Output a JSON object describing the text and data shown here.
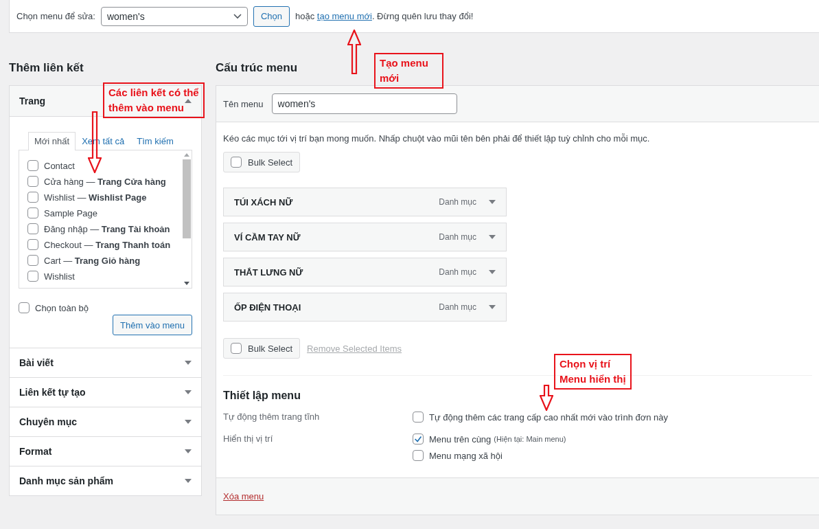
{
  "menu_select": {
    "label": "Chọn menu để sửa:",
    "value": "women's",
    "button": "Chọn",
    "text_before": "hoặc",
    "link": "tạo menu mới",
    "text_after": ". Đừng quên lưu thay đổi!"
  },
  "add_links": {
    "title": "Thêm liên kết",
    "sections": [
      {
        "title": "Trang",
        "expanded": true,
        "tabs": [
          {
            "label": "Mới nhất",
            "selected": true
          },
          {
            "label": "Xem tất cả",
            "selected": false
          },
          {
            "label": "Tìm kiếm",
            "selected": false
          }
        ],
        "items": [
          {
            "label": "Contact",
            "checked": false
          },
          {
            "label": "Cửa hàng — **Trang Cửa hàng**",
            "checked": false
          },
          {
            "label": "Wishlist — **Wishlist Page**",
            "checked": false
          },
          {
            "label": "Sample Page",
            "checked": false
          },
          {
            "label": "Đăng nhập — **Trang Tài khoản**",
            "checked": false
          },
          {
            "label": "Checkout — **Trang Thanh toán**",
            "checked": false
          },
          {
            "label": "Cart — **Trang Giỏ hàng**",
            "checked": false
          },
          {
            "label": "Wishlist",
            "checked": false
          }
        ],
        "select_all": {
          "label": "Chọn toàn bộ",
          "checked": false
        },
        "button": "Thêm vào menu"
      },
      {
        "title": "Bài viết",
        "expanded": false
      },
      {
        "title": "Liên kết tự tạo",
        "expanded": false
      },
      {
        "title": "Chuyên mục",
        "expanded": false
      },
      {
        "title": "Format",
        "expanded": false
      },
      {
        "title": "Danh mục sản phẩm",
        "expanded": false
      }
    ]
  },
  "structure": {
    "title": "Cấu trúc menu",
    "name_label": "Tên menu",
    "name_value": "women's",
    "instructions": "Kéo các mục tới vị trí bạn mong muốn. Nhấp chuột vào mũi tên bên phải để thiết lập tuỳ chỉnh cho mỗi mục.",
    "bulk_select_top": {
      "label": "Bulk Select",
      "checked": false
    },
    "items": [
      {
        "title": "TÚI XÁCH NỮ",
        "type": "Danh mục"
      },
      {
        "title": "VÍ CẦM TAY NỮ",
        "type": "Danh mục"
      },
      {
        "title": "THẮT LƯNG NỮ",
        "type": "Danh mục"
      },
      {
        "title": "ỐP ĐIỆN THOẠI",
        "type": "Danh mục"
      }
    ],
    "bulk_select_bottom": {
      "label": "Bulk Select",
      "checked": false
    },
    "remove_link": "Remove Selected Items",
    "settings": {
      "title": "Thiết lập menu",
      "rows": [
        {
          "label": "Tự động thêm trang tĩnh",
          "options": [
            {
              "label": "Tự động thêm các trang cấp cao nhất mới vào trình đơn này",
              "checked": false
            }
          ]
        },
        {
          "label": "Hiển thị vị trí",
          "options": [
            {
              "label": "Menu trên cùng",
              "note": "(Hiện tại: Main menu)",
              "checked": true
            },
            {
              "label": "Menu mạng xã hội",
              "checked": false
            }
          ]
        }
      ]
    },
    "delete_link": "Xóa menu"
  },
  "annotations": [
    {
      "lines": [
        "Tạo menu",
        "mới"
      ]
    },
    {
      "lines": [
        "Các liên kết có thể",
        "thêm vào menu"
      ]
    },
    {
      "lines": [
        "Chọn vị trí",
        "Menu hiển thị"
      ]
    }
  ]
}
